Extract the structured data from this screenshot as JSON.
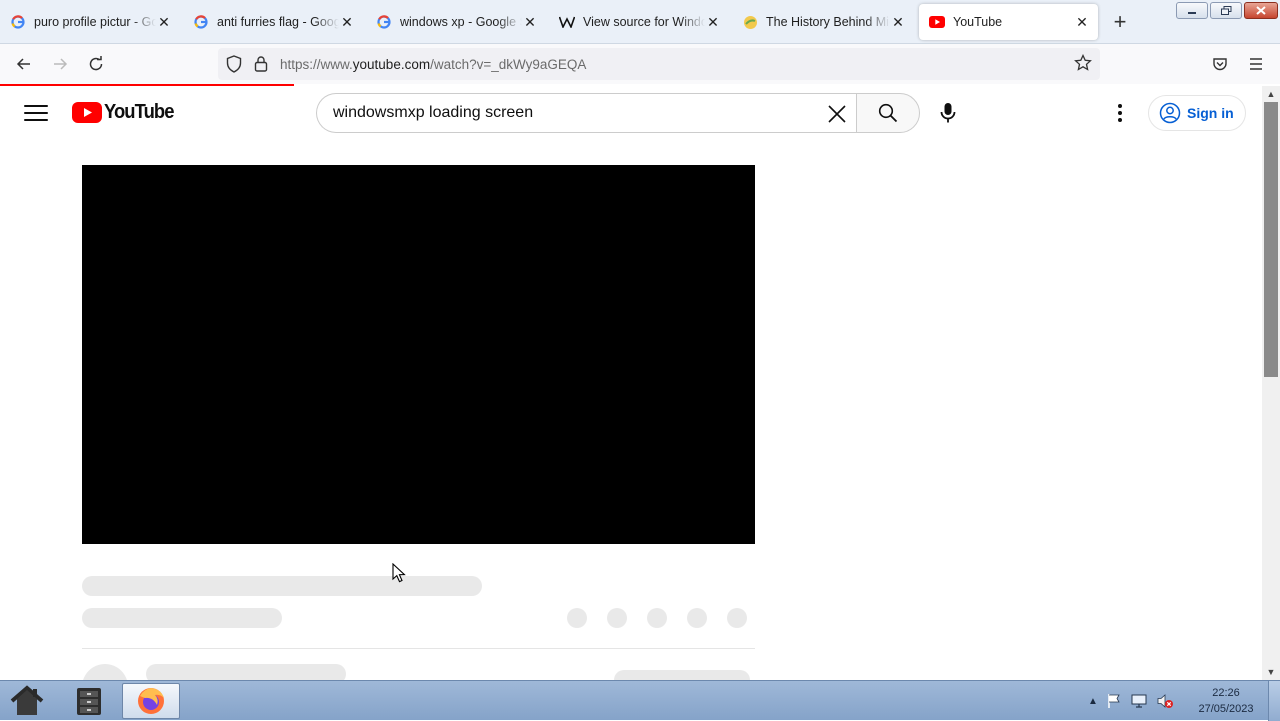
{
  "browser": {
    "tabs": [
      {
        "title": "puro profile pictur - Goo",
        "favicon": "google-g-icon"
      },
      {
        "title": "anti furries flag - Google",
        "favicon": "google-g-icon"
      },
      {
        "title": "windows xp - Google Se",
        "favicon": "google-g-icon"
      },
      {
        "title": "View source for Window",
        "favicon": "wikipedia-w-icon"
      },
      {
        "title": "The History Behind Micr",
        "favicon": "orb-icon"
      },
      {
        "title": "YouTube",
        "favicon": "youtube-icon",
        "active": true
      }
    ],
    "close_glyph": "✕",
    "new_tab_glyph": "+",
    "url_prefix": "https://www.",
    "url_host": "youtube.com",
    "url_path": "/watch?v=_dkWy9aGEQA",
    "load_progress_percent": 23
  },
  "youtube": {
    "logo_text": "YouTube",
    "search_query": "windowsmxp loading screen",
    "sign_in_label": "Sign in",
    "brand_red": "#ff0000",
    "link_blue": "#065fd4"
  },
  "taskbar": {
    "clock_time": "22:26",
    "clock_date": "27/05/2023",
    "items": [
      "home-icon",
      "file-cabinet-icon",
      "firefox-icon"
    ]
  }
}
